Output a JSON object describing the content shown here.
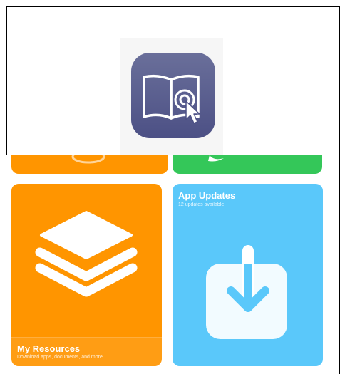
{
  "logo": {
    "icon": "book-with-cursor-icon",
    "accent": "#5a5e92"
  },
  "tiles": {
    "top_left": {
      "color": "#ff9500"
    },
    "top_right": {
      "color": "#34c759"
    },
    "resources": {
      "title": "My Resources",
      "subtitle": "Download apps, documents, and more",
      "icon": "stacked-layers-icon",
      "color": "#ff9500"
    },
    "updates": {
      "title": "App Updates",
      "subtitle": "12 updates available",
      "icon": "download-arrow-icon",
      "color": "#5ac8fa"
    }
  }
}
